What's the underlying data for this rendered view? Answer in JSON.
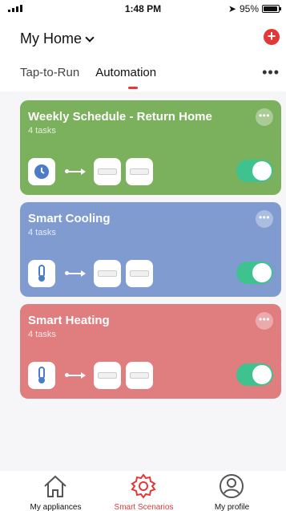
{
  "status_bar": {
    "time": "1:48 PM",
    "battery": "95%",
    "location_icon": "location-arrow-icon"
  },
  "header": {
    "home_title": "My Home",
    "add_icon": "plus-icon",
    "more_icon": "more-icon"
  },
  "tabs": [
    {
      "label": "Tap-to-Run",
      "active": false
    },
    {
      "label": "Automation",
      "active": true
    }
  ],
  "cards": [
    {
      "title": "Weekly Schedule - Return Home",
      "subtitle": "4 tasks",
      "trigger_icon": "clock-icon",
      "color": "#7bb05c",
      "enabled": true
    },
    {
      "title": "Smart Cooling",
      "subtitle": "4 tasks",
      "trigger_icon": "thermometer-icon",
      "color": "#7f9bd0",
      "enabled": true
    },
    {
      "title": "Smart Heating",
      "subtitle": "4 tasks",
      "trigger_icon": "thermometer-icon",
      "color": "#e07d7e",
      "enabled": true
    }
  ],
  "bottom_nav": [
    {
      "label": "My appliances",
      "icon": "home-icon",
      "active": false
    },
    {
      "label": "Smart Scenarios",
      "icon": "gear-icon",
      "active": true
    },
    {
      "label": "My profile",
      "icon": "user-icon",
      "active": false
    }
  ],
  "colors": {
    "accent": "#e23838",
    "toggle_on": "#3ec28f"
  }
}
